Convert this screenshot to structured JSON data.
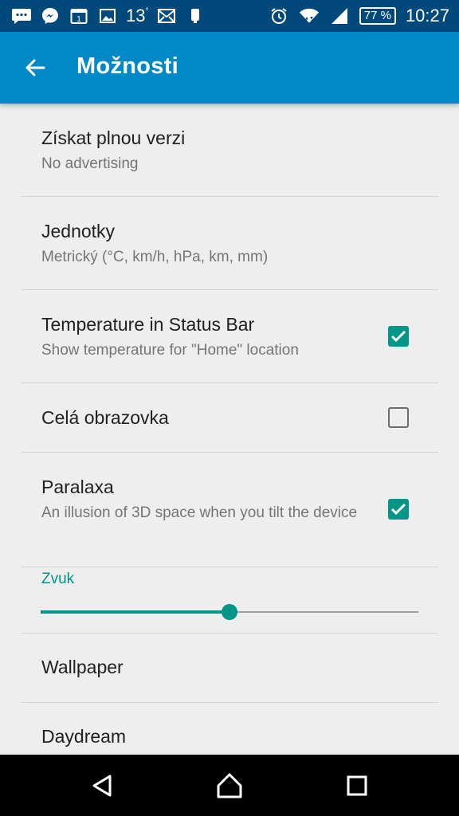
{
  "status_bar": {
    "temperature": "13",
    "temperature_unit": "°",
    "calendar_day": "1",
    "battery_percent": "77 %",
    "time": "10:27",
    "icons": [
      "messages-icon",
      "messenger-icon",
      "calendar-icon",
      "gallery-icon",
      "weather-temp",
      "email-icon",
      "phone-icon",
      "alarm-icon",
      "wifi-icon",
      "signal-icon",
      "battery-icon"
    ]
  },
  "app_bar": {
    "title": "Možnosti",
    "back_icon": "arrow-back-icon",
    "background": "#0189c7"
  },
  "settings": [
    {
      "title": "Získat plnou verzi",
      "summary": "No advertising"
    },
    {
      "title": "Jednotky",
      "summary": "Metrický (°C, km/h, hPa, km, mm)"
    },
    {
      "title": "Temperature in Status Bar",
      "summary": "Show temperature for \"Home\" location",
      "checked": true
    },
    {
      "title": "Celá obrazovka",
      "checked": false
    },
    {
      "title": "Paralaxa",
      "summary": "An illusion of 3D space when you tilt the device",
      "checked": true
    },
    {
      "title": "Wallpaper"
    },
    {
      "title": "Daydream"
    }
  ],
  "sound_slider": {
    "label": "Zvuk",
    "value_fraction": 0.5
  },
  "colors": {
    "accent": "#009688",
    "status_bar": "#01497a",
    "background": "#eeeeee"
  },
  "nav_bar": {
    "icons": [
      "back-triangle-icon",
      "home-icon",
      "recents-icon"
    ]
  }
}
